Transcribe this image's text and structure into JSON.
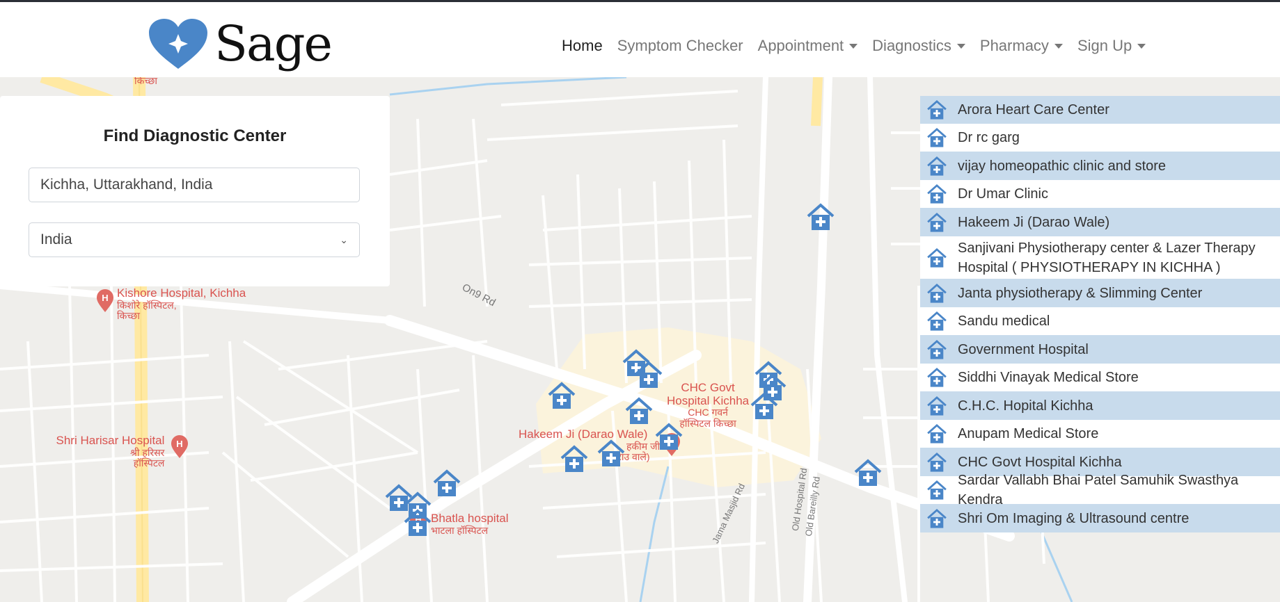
{
  "app": {
    "brand": "Sage",
    "brand_color": "#4a86c8"
  },
  "nav": {
    "items": [
      {
        "label": "Home",
        "active": true,
        "dropdown": false
      },
      {
        "label": "Symptom Checker",
        "active": false,
        "dropdown": false
      },
      {
        "label": "Appointment",
        "active": false,
        "dropdown": true
      },
      {
        "label": "Diagnostics",
        "active": false,
        "dropdown": true
      },
      {
        "label": "Pharmacy",
        "active": false,
        "dropdown": true
      },
      {
        "label": "Sign Up",
        "active": false,
        "dropdown": true
      }
    ]
  },
  "search_panel": {
    "title": "Find Diagnostic Center",
    "location_value": "Kichha, Uttarakhand, India",
    "country_selected": "India"
  },
  "results": [
    "Arora Heart Care Center",
    "Dr rc garg",
    "vijay homeopathic clinic and store",
    "Dr Umar Clinic",
    "Hakeem Ji (Darao Wale)",
    "Sanjivani Physiotherapy center & Lazer Therapy Hospital ( PHYSIOTHERAPY IN KICHHA )",
    "Janta physiotherapy & Slimming Center",
    "Sandu medical",
    "Government Hospital",
    "Siddhi Vinayak Medical Store",
    "C.H.C. Hopital Kichha",
    "Anupam Medical Store",
    "CHC Govt Hospital Kichha",
    "Sardar Vallabh Bhai Patel Samuhik Swasthya Kendra",
    "Shri Om Imaging & Ultrasound centre"
  ],
  "map": {
    "labels": {
      "kichha_top": "किच्छा",
      "kishore_name": "Kishore Hospital, Kichha",
      "kishore_hindi1": "किशोरे हॉस्पिटल,",
      "kishore_hindi2": "किच्छा",
      "harisar_name": "Shri Harisar Hospital",
      "harisar_hindi1": "श्री हरिसर",
      "harisar_hindi2": "हॉस्पिटल",
      "chc_name1": "CHC Govt",
      "chc_name2": "Hospital Kichha",
      "chc_hindi1": "CHC गवर्न",
      "chc_hindi2": "हॉस्पिटल किच्छा",
      "hakeem_name": "Hakeem Ji (Darao Wale)",
      "hakeem_hindi1": "हकीम जी",
      "hakeem_hindi2": "(दराउ वाले)",
      "bhatla_name": "Bhatla hospital",
      "bhatla_hindi": "भाटला हॉस्पिटल",
      "road_o9": "On9 Rd",
      "road_jama": "Jama Masjid Rd",
      "road_hospital": "Old Hospital Rd",
      "road_bareilly": "Old Bareilly Rd"
    },
    "marker_icon": "hospital-marker-icon",
    "marker_color": "#4a86c8",
    "poi_color": "#d9534f"
  }
}
